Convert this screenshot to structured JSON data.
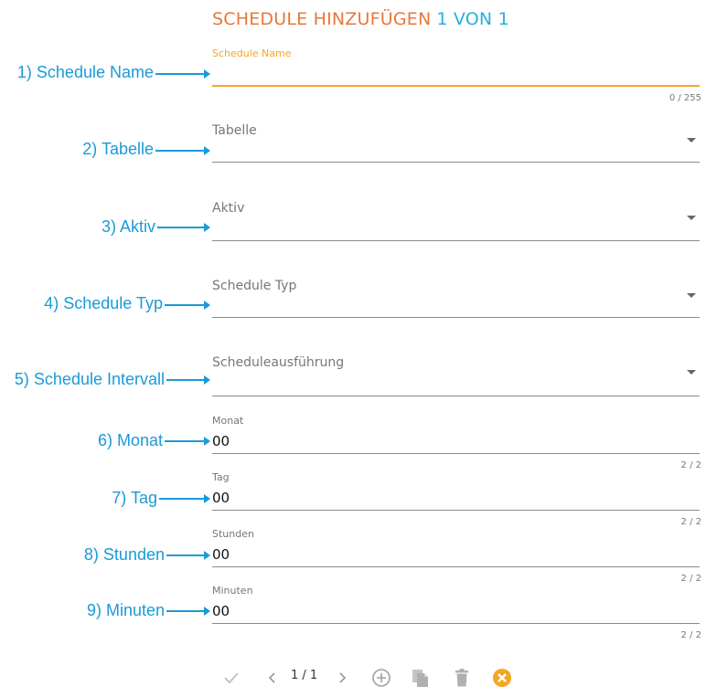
{
  "header": {
    "title": "SCHEDULE HINZUFÜGEN",
    "record_counter": "1 VON 1"
  },
  "annotations": [
    "1) Schedule Name",
    "2) Tabelle",
    "3) Aktiv",
    "4) Schedule Typ",
    "5) Schedule Intervall",
    "6) Monat",
    "7) Tag",
    "8) Stunden",
    "9) Minuten"
  ],
  "fields": {
    "schedule_name": {
      "label": "Schedule Name",
      "value": "",
      "counter": "0 / 255"
    },
    "tabelle": {
      "label": "Tabelle"
    },
    "aktiv": {
      "label": "Aktiv"
    },
    "schedule_typ": {
      "label": "Schedule Typ"
    },
    "scheduleausfuehrung": {
      "label": "Scheduleausführung"
    },
    "monat": {
      "label": "Monat",
      "value": "00",
      "counter": "2 / 2"
    },
    "tag": {
      "label": "Tag",
      "value": "00",
      "counter": "2 / 2"
    },
    "stunden": {
      "label": "Stunden",
      "value": "00",
      "counter": "2 / 2"
    },
    "minuten": {
      "label": "Minuten",
      "value": "00",
      "counter": "2 / 2"
    }
  },
  "toolbar": {
    "pager": "1 / 1",
    "icons": [
      "check-icon",
      "chevron-left-icon",
      "chevron-right-icon",
      "add-circle-icon",
      "copy-icon",
      "delete-icon",
      "cancel-icon"
    ],
    "cancel_color": "#f5a623"
  },
  "colors": {
    "accent": "#f5a623",
    "title": "#e8773a",
    "annotation": "#1a9ad8"
  }
}
